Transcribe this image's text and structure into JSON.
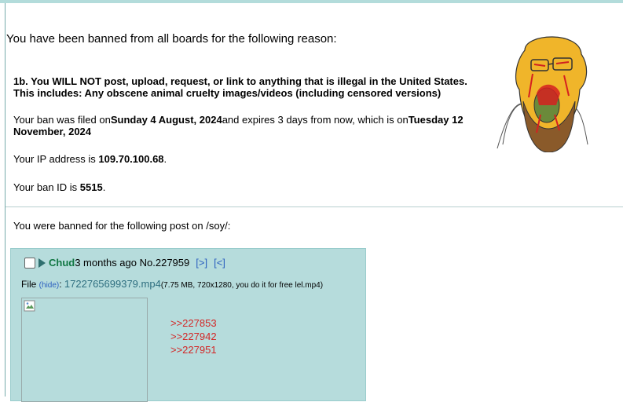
{
  "ban": {
    "headline": "You have been banned from all boards for the following reason:",
    "reason_line1": "1b. You WILL NOT post, upload, request, or link to anything that is illegal in the United States.",
    "reason_line2": "This includes: Any obscene animal cruelty images/videos (including censored versions)",
    "filed_prefix": "Your ban was filed on",
    "filed_date": "Sunday 4 August, 2024",
    "filed_middle": "and expires 3 days from now, which is on",
    "expire_date": "Tuesday 12 November, 2024",
    "ip_prefix": "Your IP address is ",
    "ip": "109.70.100.68",
    "ip_suffix": ".",
    "banid_prefix": "Your ban ID is ",
    "banid": "5515",
    "banid_suffix": ".",
    "post_intro": "You were banned for the following post on /soy/:"
  },
  "post": {
    "name": "Chud",
    "time": "3 months ago",
    "number": "No.227959",
    "nav_next": "[>]",
    "nav_prev": "[<]",
    "file_label": "File ",
    "hide_label": "(hide)",
    "colon": ": ",
    "filename": "1722765699379.mp4",
    "file_meta": "(7.75 MB, 720x1280, you do it for free lel.mp4)",
    "replies": [
      ">>227853",
      ">>227942",
      ">>227951"
    ]
  }
}
